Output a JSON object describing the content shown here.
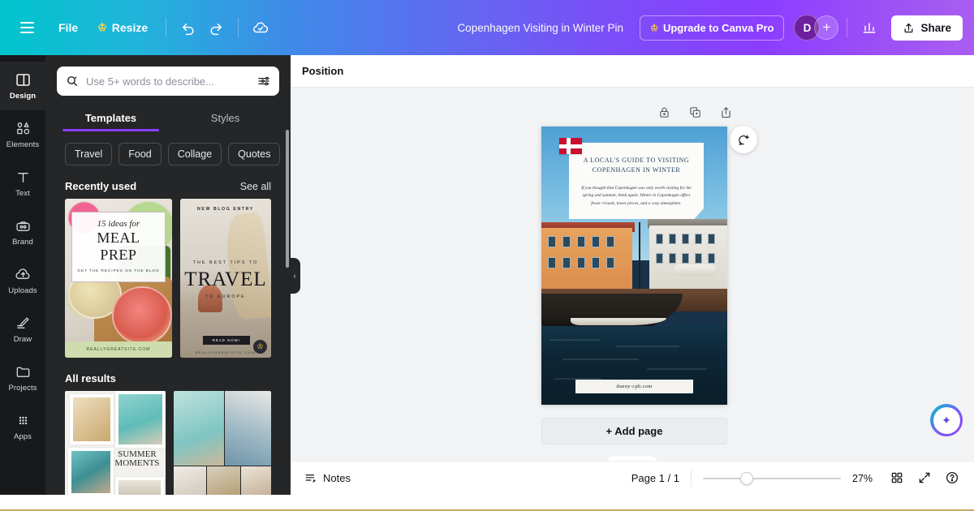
{
  "topbar": {
    "menu_icon": "hamburger-icon",
    "file_label": "File",
    "resize_label": "Resize",
    "resize_crown": "♔",
    "undo_icon": "undo-icon",
    "redo_icon": "redo-icon",
    "cloud_icon": "cloud-saved-icon",
    "doc_title": "Copenhagen Visiting in Winter Pin",
    "upgrade_label": "Upgrade to Canva Pro",
    "upgrade_crown": "♔",
    "avatar_initial": "D",
    "avatar_add": "+",
    "insights_icon": "bar-chart-icon",
    "share_label": "Share",
    "share_icon": "share-upload-icon",
    "gradient_start": "#00C4CC",
    "gradient_end": "#8B3DFF"
  },
  "rail": {
    "items": [
      {
        "label": "Design",
        "icon": "design-icon",
        "active": true
      },
      {
        "label": "Elements",
        "icon": "elements-icon",
        "active": false
      },
      {
        "label": "Text",
        "icon": "text-icon",
        "active": false
      },
      {
        "label": "Brand",
        "icon": "brand-icon",
        "active": false
      },
      {
        "label": "Uploads",
        "icon": "uploads-icon",
        "active": false
      },
      {
        "label": "Draw",
        "icon": "draw-icon",
        "active": false
      },
      {
        "label": "Projects",
        "icon": "projects-icon",
        "active": false
      },
      {
        "label": "Apps",
        "icon": "apps-icon",
        "active": false
      }
    ]
  },
  "panel": {
    "search": {
      "placeholder": "Use 5+ words to describe...",
      "value": "",
      "magic_icon": "magic-search-icon",
      "filter_icon": "filter-sliders-icon"
    },
    "tabs": [
      {
        "label": "Templates",
        "active": true
      },
      {
        "label": "Styles",
        "active": false
      }
    ],
    "chips": [
      "Travel",
      "Food",
      "Collage",
      "Quotes"
    ],
    "chips_more_icon": "chevron-right-icon",
    "recent": {
      "title": "Recently used",
      "see_all": "See all",
      "items": [
        {
          "name": "meal-prep-template",
          "line1": "15 ideas for",
          "line2": "MEAL PREP",
          "line3": "GET THE RECIPES ON THE BLOG",
          "footer": "REALLYGREATSITE.COM",
          "pro": false
        },
        {
          "name": "travel-europe-template",
          "top": "NEW BLOG ENTRY",
          "sub": "THE BEST TIPS TO",
          "main": "TRAVEL",
          "sub2": "TO EUROPE",
          "cta": "READ NOW!",
          "url": "REALLYGREATSITE.COM",
          "pro": true,
          "pro_badge": "♔"
        }
      ]
    },
    "all_results": {
      "title": "All results",
      "items": [
        {
          "name": "summer-moments-collage",
          "caption": "SUMMER MOMENTS"
        },
        {
          "name": "beach-grid-collage",
          "caption": ""
        }
      ]
    },
    "collapse_icon": "chevron-left-icon"
  },
  "editor": {
    "toolbar": {
      "position_label": "Position"
    },
    "float_tools": [
      {
        "name": "lock-icon",
        "label": "Lock"
      },
      {
        "name": "duplicate-icon",
        "label": "Duplicate page"
      },
      {
        "name": "export-page-icon",
        "label": "Export page"
      }
    ],
    "comment_fab_icon": "add-comment-icon",
    "add_page_label": "+ Add page",
    "collapse_notch_icon": "chevron-up-icon",
    "design": {
      "flag": "danish-flag",
      "title": "A LOCAL'S GUIDE TO VISITING COPENHAGEN IN WINTER",
      "title_line1": "A LOCAL'S GUIDE TO VISITING",
      "title_line2": "COPENHAGEN IN WINTER",
      "body": "If you thought that Copenhagen was only worth visiting for the spring and summer, think again. Winter in Copenhagen offers fewer crowds, lower prices, and a cosy atmosphere.",
      "url": "danny-cph.com",
      "scene_label": "Nyhavn harbour photo"
    }
  },
  "statusbar": {
    "notes_label": "Notes",
    "notes_icon": "notes-icon",
    "page_indicator": "Page 1 / 1",
    "zoom_value": "27%",
    "zoom_percent": 27,
    "grid_icon": "grid-view-icon",
    "fullscreen_icon": "fullscreen-icon",
    "help_icon": "help-icon"
  },
  "ai_fab": {
    "icon": "magic-sparkle-icon",
    "glyph": "✦"
  }
}
